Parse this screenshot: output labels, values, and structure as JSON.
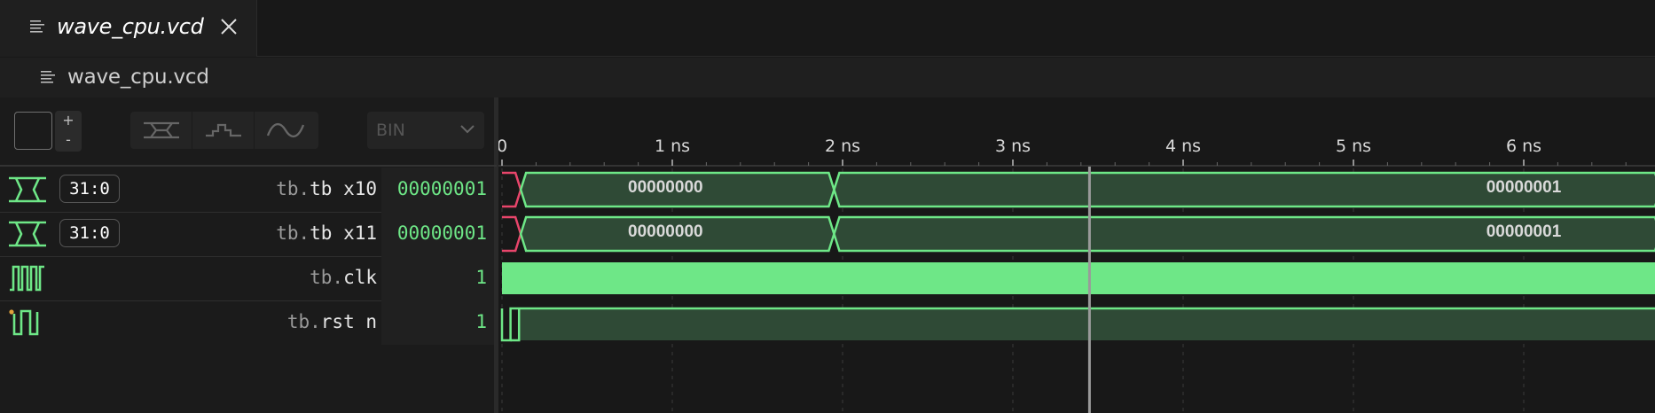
{
  "tab": {
    "title": "wave_cpu.vcd",
    "icon": "file-lines-icon",
    "close_icon": "close-icon"
  },
  "breadcrumb": {
    "title": "wave_cpu.vcd",
    "icon": "file-lines-icon"
  },
  "toolbar": {
    "color_swatch": "#1b1b1b",
    "plus_label": "+",
    "minus_label": "-",
    "render_modes": [
      "bus-icon",
      "step-icon",
      "analog-icon"
    ],
    "format_value": "BIN",
    "format_icon": "chevron-down-icon"
  },
  "timeline": {
    "ticks": [
      "0",
      "1 ns",
      "2 ns",
      "3 ns",
      "4 ns",
      "5 ns",
      "6 ns"
    ],
    "cursor_ns": 3.45
  },
  "signals": [
    {
      "icon": "bus-signal-icon",
      "width": "31:0",
      "scope": "tb.",
      "name": "tb x10",
      "value": "00000001",
      "segments": [
        "00000000",
        "00000001"
      ]
    },
    {
      "icon": "bus-signal-icon",
      "width": "31:0",
      "scope": "tb.",
      "name": "tb x11",
      "value": "00000001",
      "segments": [
        "00000000",
        "00000001"
      ]
    },
    {
      "icon": "clock-signal-icon",
      "width": "",
      "scope": "tb.",
      "name": "clk",
      "value": "1"
    },
    {
      "icon": "reset-signal-icon",
      "width": "",
      "scope": "tb.",
      "name": "rst n",
      "value": "1"
    }
  ],
  "colors": {
    "signal": "#6ee787",
    "signal_fill": "#2f4a36",
    "undefined": "#e8456b",
    "cursor": "#9a9a9a"
  }
}
